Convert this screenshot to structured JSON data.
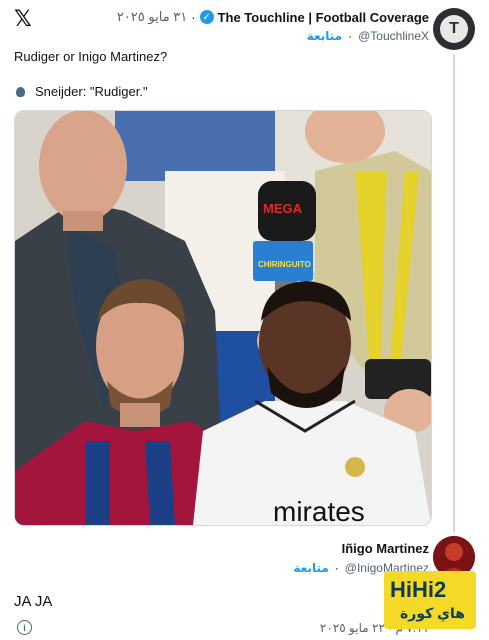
{
  "tweet": {
    "account_name": "The Touchline | Football Coverage",
    "date": "٣١ مايو ٢٠٢٥",
    "handle": "@TouchlineX",
    "follow_label": "متابعة",
    "avatar_letter": "T",
    "text": "Rudiger or Inigo Martinez?",
    "quote": "Sneijder: \"Rudiger.\"",
    "image": {
      "mic_brand": "MEGA",
      "mic_show": "CHIRINGUITO",
      "jersey_text": "mirates"
    }
  },
  "reply": {
    "account_name": "Iñigo Martinez",
    "handle": "@InigoMartinez",
    "follow_label": "متابعة",
    "text": "JA JA",
    "date": "٧:١١ م · ٢٢ مايو ٢٠٢٥"
  },
  "watermark": {
    "top": "HiHi2",
    "bottom": "هاي كورة"
  },
  "colors": {
    "accent": "#1d9bf0",
    "secondary_text": "#536471",
    "watermark_bg": "#f4d928"
  },
  "icons": [
    "x-logo-icon",
    "verified-icon",
    "speaking-head-icon",
    "info-icon"
  ]
}
